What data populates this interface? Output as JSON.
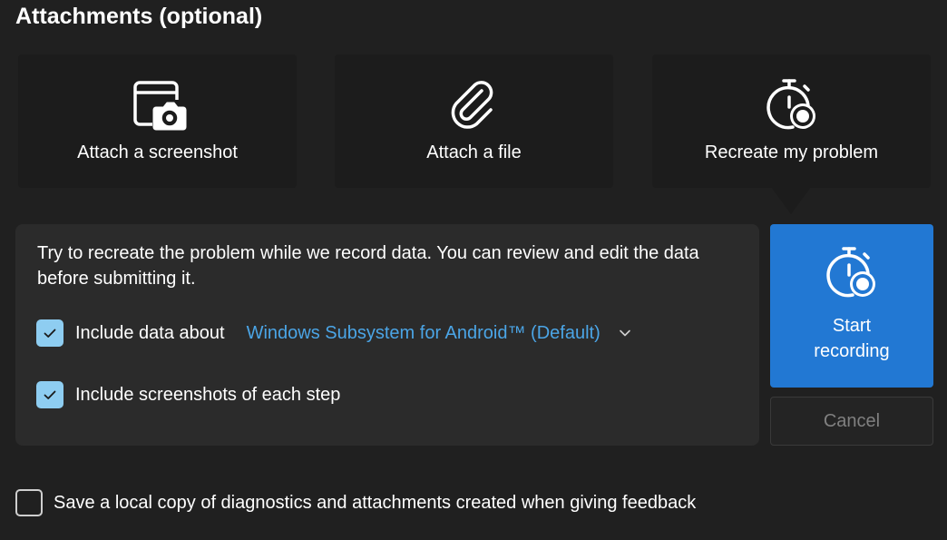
{
  "section": {
    "title": "Attachments (optional)"
  },
  "tiles": [
    {
      "label": "Attach a screenshot",
      "icon": "screenshot-camera-icon"
    },
    {
      "label": "Attach a file",
      "icon": "paperclip-icon"
    },
    {
      "label": "Recreate my problem",
      "icon": "stopwatch-record-icon",
      "selected": true
    }
  ],
  "recording_panel": {
    "description": "Try to recreate the problem while we record data. You can review and edit the data before submitting it.",
    "include_data": {
      "label": "Include data about",
      "checked": true,
      "selected_source": "Windows Subsystem for Android™ (Default)",
      "dropdown_icon": "chevron-down-icon"
    },
    "include_screenshots": {
      "label": "Include screenshots of each step",
      "checked": true
    }
  },
  "actions": {
    "start_label": "Start recording",
    "start_icon": "stopwatch-record-icon",
    "cancel_label": "Cancel",
    "cancel_enabled": false
  },
  "save_local_copy": {
    "label": "Save a local copy of diagnostics and attachments created when giving feedback",
    "checked": false
  },
  "colors": {
    "background": "#202020",
    "tile": "#1c1c1c",
    "panel": "#2b2b2b",
    "accent": "#2278d3",
    "link": "#4ba5e6",
    "checkbox_checked": "#8ecdf1",
    "disabled_text": "#808080"
  }
}
